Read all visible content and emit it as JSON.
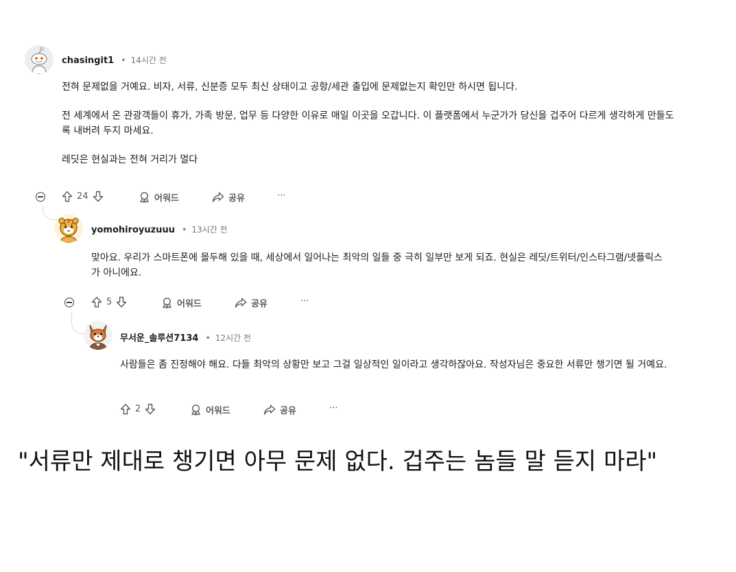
{
  "comments": [
    {
      "username": "chasingit1",
      "separator": "•",
      "time": "14시간 전",
      "paragraphs": [
        "전혀 문제없을 거예요. 비자, 서류, 신분증 모두 최신 상태이고 공항/세관 출입에 문제없는지 확인만 하시면 됩니다.",
        "전 세계에서 온 관광객들이 휴가, 가족 방문, 업무 등 다양한 이유로 매일 이곳을 오갑니다. 이 플랫폼에서 누군가가 당신을 겁주어 다르게 생각하게 만들도록 내버려 두지 마세요.",
        "레딧은 현실과는 전혀 거리가 멀다"
      ],
      "votes": "24",
      "award_label": "어워드",
      "share_label": "공유",
      "more_label": "···"
    },
    {
      "username": "yomohiroyuzuuu",
      "separator": "•",
      "time": "13시간 전",
      "paragraphs": [
        "맞아요. 우리가 스마트폰에 몰두해 있을 때, 세상에서 일어나는 최악의 일들 중 극히 일부만 보게 되죠. 현실은 레딧/트위터/인스타그램/넷플릭스가 아니에요."
      ],
      "votes": "5",
      "award_label": "어워드",
      "share_label": "공유",
      "more_label": "···"
    },
    {
      "username": "무서운_솔루션7134",
      "separator": "•",
      "time": "12시간 전",
      "paragraphs": [
        "사람들은 좀 진정해야 해요. 다들 최악의 상황만 보고 그걸 일상적인 일이라고 생각하잖아요. 작성자님은 중요한 서류만 챙기면 될 거예요."
      ],
      "votes": "2",
      "award_label": "어워드",
      "share_label": "공유",
      "more_label": "···"
    }
  ],
  "caption": "\"서류만 제대로 챙기면 아무 문제 없다. 겁주는 놈들 말 듣지 마라\"",
  "icons": {
    "upvote": "upvote-icon",
    "downvote": "downvote-icon",
    "award": "award-icon",
    "share": "share-icon",
    "collapse": "collapse-icon"
  },
  "colors": {
    "text": "#1c1c1c",
    "meta": "#6f7a80",
    "action": "#555d61",
    "thread": "#d8d8d8"
  }
}
